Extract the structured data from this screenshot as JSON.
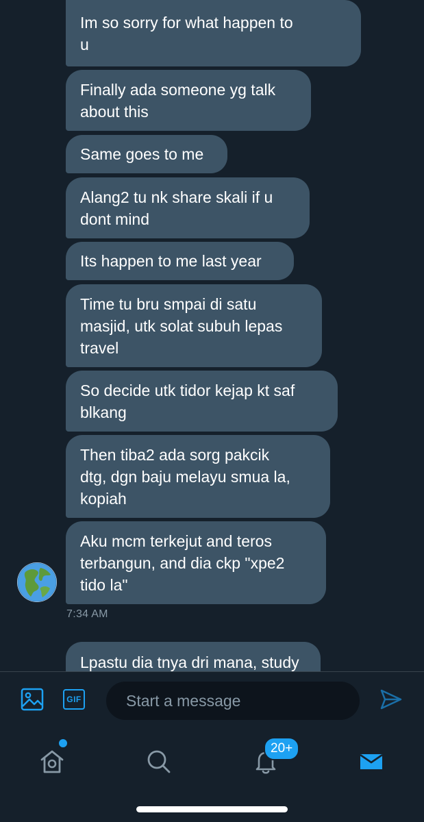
{
  "conversation": {
    "messages": [
      {
        "lines": [
          "Im so sorry for what happen to",
          "u"
        ]
      },
      {
        "lines": [
          "Finally ada someone yg talk",
          "about this"
        ]
      },
      {
        "lines": [
          "Same goes to me"
        ]
      },
      {
        "lines": [
          "Alang2 tu nk share skali if u",
          "dont mind"
        ]
      },
      {
        "lines": [
          "Its happen to me last year"
        ]
      },
      {
        "lines": [
          "Time tu bru smpai di satu",
          "masjid, utk solat subuh lepas",
          "travel"
        ]
      },
      {
        "lines": [
          "So decide utk tidor kejap kt saf",
          "blkang"
        ]
      },
      {
        "lines": [
          "Then tiba2 ada sorg pakcik",
          "dtg, dgn baju melayu smua la,",
          "kopiah"
        ]
      },
      {
        "lines": [
          "Aku mcm terkejut and teros",
          "terbangun, and dia ckp \"xpe2",
          "tido la\""
        ]
      },
      {
        "lines": [
          "Lpastu dia tnya dri mana, study"
        ]
      }
    ],
    "timestamp": "7:34 AM",
    "avatar_icon": "earth-globe-icon"
  },
  "composer": {
    "placeholder": "Start a message",
    "gif_label": "GIF",
    "image_icon": "image-icon",
    "send_icon": "send-icon"
  },
  "tabbar": {
    "items": [
      {
        "name": "home",
        "icon": "home-icon",
        "has_dot": true
      },
      {
        "name": "search",
        "icon": "search-icon"
      },
      {
        "name": "notifications",
        "icon": "bell-icon",
        "badge": "20+"
      },
      {
        "name": "messages",
        "icon": "mail-icon",
        "active": true
      }
    ]
  },
  "colors": {
    "background": "#15202b",
    "bubble": "#3d5466",
    "accent": "#1da1f2",
    "muted_text": "#8899a6"
  }
}
